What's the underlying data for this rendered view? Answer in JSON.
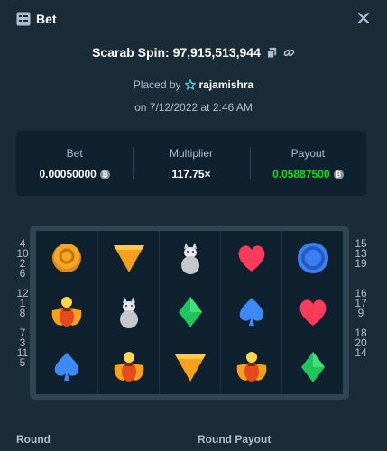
{
  "header": {
    "title": "Bet",
    "icon": "bet-list-icon",
    "close_icon": "close-icon"
  },
  "spin": {
    "label": "Scarab Spin: 97,915,513,944",
    "copy_icon": "copy-icon",
    "link_icon": "link-icon"
  },
  "placed": {
    "prefix": "Placed by",
    "user_icon": "star-icon",
    "username": "rajamishra"
  },
  "date": "on 7/12/2022 at 2:46 AM",
  "stats": {
    "bet_label": "Bet",
    "bet_value": "0.00050000",
    "multiplier_label": "Multiplier",
    "multiplier_value": "117.75×",
    "payout_label": "Payout",
    "payout_value": "0.05887500",
    "currency_icon": "coin-icon",
    "payout_color": "#00e701"
  },
  "paylines": {
    "left": [
      "4",
      "10",
      "2",
      "6",
      "",
      "12",
      "1",
      "8",
      "",
      "7",
      "3",
      "11",
      "5"
    ],
    "right": [
      "15",
      "13",
      "19",
      "",
      "",
      "16",
      "17",
      "9",
      "",
      "18",
      "20",
      "14",
      ""
    ]
  },
  "grid": [
    [
      "gold-coin",
      "orange-triangle",
      "grey-cat",
      "red-heart",
      "blue-circle"
    ],
    [
      "scarab",
      "grey-cat",
      "green-diamond",
      "blue-spade",
      "red-heart"
    ],
    [
      "blue-spade",
      "scarab",
      "orange-triangle",
      "scarab",
      "green-diamond"
    ]
  ],
  "footer": {
    "round_label": "Round",
    "round_payout_label": "Round Payout"
  }
}
